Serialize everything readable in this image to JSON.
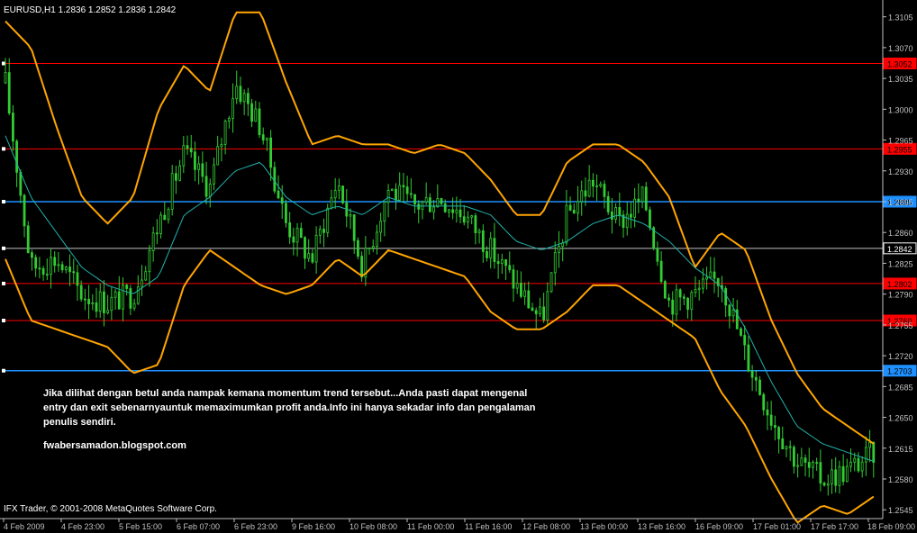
{
  "chart_data": {
    "type": "candlestick",
    "title": "EURUSD,H1  1.2836 1.2852 1.2836 1.2842",
    "symbol": "EURUSD",
    "timeframe": "H1",
    "ohlc": {
      "open": 1.2836,
      "high": 1.2852,
      "low": 1.2836,
      "close": 1.2842
    },
    "ylim": [
      1.2535,
      1.312
    ],
    "y_ticks": [
      "1.3105",
      "1.3070",
      "1.3035",
      "1.3000",
      "1.2965",
      "1.2930",
      "1.2895",
      "1.2860",
      "1.2825",
      "1.2790",
      "1.2755",
      "1.2720",
      "1.2685",
      "1.2650",
      "1.2615",
      "1.2580",
      "1.2545"
    ],
    "x_ticks": [
      "4 Feb 2009",
      "4 Feb 23:00",
      "5 Feb 15:00",
      "6 Feb 07:00",
      "6 Feb 23:00",
      "9 Feb 16:00",
      "10 Feb 08:00",
      "11 Feb 00:00",
      "11 Feb 16:00",
      "12 Feb 08:00",
      "13 Feb 00:00",
      "13 Feb 16:00",
      "16 Feb 09:00",
      "17 Feb 01:00",
      "17 Feb 17:00",
      "18 Feb 09:00"
    ],
    "horizontal_lines": [
      {
        "price": 1.3052,
        "label": "1.3052",
        "color": "#ff0000"
      },
      {
        "price": 1.2955,
        "label": "1.2955",
        "color": "#ff0000"
      },
      {
        "price": 1.2895,
        "label": "1.2895",
        "color": "#1e90ff"
      },
      {
        "price": 1.2842,
        "label": "1.2842",
        "color": "#c0c0c0"
      },
      {
        "price": 1.2802,
        "label": "1.2802",
        "color": "#ff0000"
      },
      {
        "price": 1.276,
        "label": "1.2760",
        "color": "#ff0000"
      },
      {
        "price": 1.2703,
        "label": "1.2703",
        "color": "#1e90ff"
      }
    ],
    "series_key_points": {
      "price_close": [
        1.303,
        1.282,
        1.283,
        1.279,
        1.278,
        1.279,
        1.287,
        1.295,
        1.291,
        1.303,
        1.298,
        1.287,
        1.283,
        1.292,
        1.282,
        1.291,
        1.289,
        1.29,
        1.288,
        1.284,
        1.28,
        1.276,
        1.288,
        1.292,
        1.287,
        1.29,
        1.278,
        1.279,
        1.281,
        1.272,
        1.265,
        1.26,
        1.258,
        1.259,
        1.261
      ],
      "moving_average": [
        1.297,
        1.29,
        1.286,
        1.282,
        1.28,
        1.279,
        1.281,
        1.288,
        1.29,
        1.293,
        1.294,
        1.29,
        1.288,
        1.289,
        1.288,
        1.29,
        1.289,
        1.289,
        1.289,
        1.288,
        1.285,
        1.284,
        1.285,
        1.287,
        1.288,
        1.287,
        1.285,
        1.282,
        1.28,
        1.275,
        1.269,
        1.264,
        1.262,
        1.261,
        1.26
      ],
      "upper_band": [
        1.31,
        1.307,
        1.298,
        1.29,
        1.287,
        1.29,
        1.3,
        1.305,
        1.302,
        1.311,
        1.311,
        1.303,
        1.296,
        1.297,
        1.296,
        1.296,
        1.295,
        1.296,
        1.295,
        1.292,
        1.288,
        1.288,
        1.294,
        1.296,
        1.296,
        1.294,
        1.29,
        1.282,
        1.286,
        1.284,
        1.276,
        1.27,
        1.266,
        1.264,
        1.262
      ],
      "lower_band": [
        1.283,
        1.276,
        1.275,
        1.274,
        1.273,
        1.27,
        1.271,
        1.28,
        1.284,
        1.282,
        1.28,
        1.279,
        1.28,
        1.283,
        1.281,
        1.284,
        1.283,
        1.282,
        1.281,
        1.277,
        1.275,
        1.275,
        1.277,
        1.28,
        1.28,
        1.278,
        1.276,
        1.274,
        1.268,
        1.264,
        1.258,
        1.253,
        1.255,
        1.254,
        1.256
      ]
    },
    "grid": false,
    "annotation": "Jika dilihat dengan betul anda nampak kemana momentum trend tersebut...Anda pasti dapat mengenal\nentry dan exit sebenarnyauntuk memaximumkan profit anda.Info ini hanya sekadar info dan pengalaman\npenulis sendiri.",
    "blog": "fwabersamadon.blogspot.com",
    "copyright": "IFX Trader, © 2001-2008 MetaQuotes Software Corp."
  },
  "colors": {
    "background": "#000000",
    "candle": "#32cd32",
    "bands": "#ffa500",
    "moving_average": "#20b2aa",
    "axis": "#c0c0c0",
    "text": "#ffffff"
  }
}
